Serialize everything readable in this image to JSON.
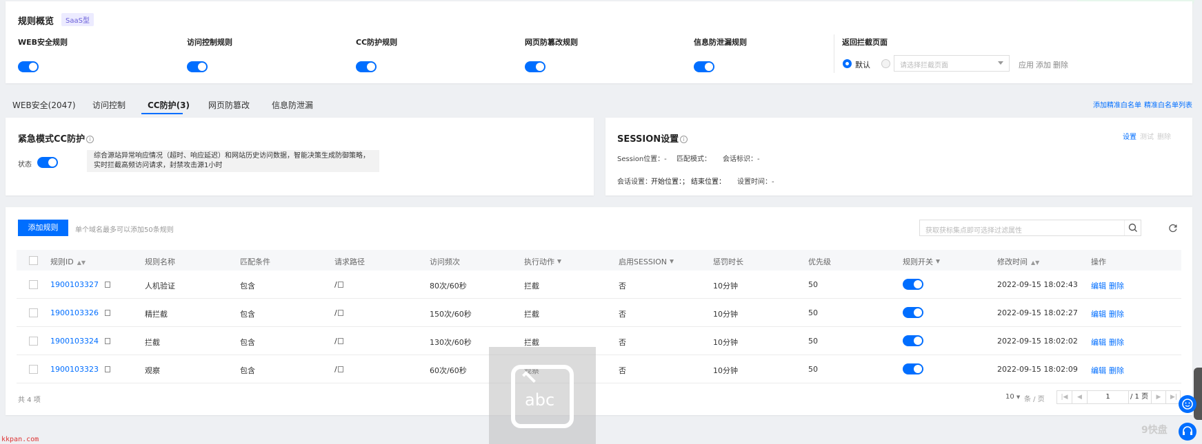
{
  "overview": {
    "title": "规则概览",
    "badge": "SaaS型",
    "rules": [
      {
        "label": "WEB安全规则"
      },
      {
        "label": "访问控制规则"
      },
      {
        "label": "CC防护规则"
      },
      {
        "label": "网页防篡改规则"
      },
      {
        "label": "信息防泄漏规则"
      }
    ],
    "return_page": {
      "label": "返回拦截页面",
      "default_option": "默认",
      "select_placeholder": "请选择拦截页面",
      "apply": "应用",
      "add": "添加",
      "delete": "删除"
    }
  },
  "tabs": [
    {
      "label": "WEB安全(2047)"
    },
    {
      "label": "访问控制"
    },
    {
      "label": "CC防护(3)"
    },
    {
      "label": "网页防篡改"
    },
    {
      "label": "信息防泄漏"
    }
  ],
  "top_links": {
    "add_whitelist": "添加精准白名单",
    "whitelist_list": "精准白名单列表"
  },
  "emergency": {
    "title": "紧急模式CC防护",
    "status_label": "状态",
    "description_line1": "综合源站异常响应情况（超时、响应延迟）和网站历史访问数据，智能决策生成防御策略，",
    "description_line2": "实时拦截高频访问请求，封禁攻击源1小时"
  },
  "session": {
    "title": "SESSION设置",
    "actions": {
      "set": "设置",
      "test": "测试",
      "delete": "删除"
    },
    "fields": {
      "position": "Session位置：-",
      "match_mode": "匹配模式：",
      "session_id": "会话标识：-",
      "session_setting": "会话设置：",
      "start_pos": "开始位置：；",
      "end_pos": "结束位置：",
      "set_time": "设置时间：-"
    }
  },
  "rules_table": {
    "add_button": "添加规则",
    "hint": "单个域名最多可以添加50条规则",
    "search_placeholder": "获取获标集点即可选择过滤属性",
    "columns": [
      {
        "label": "规则ID",
        "sort": true
      },
      {
        "label": "规则名称"
      },
      {
        "label": "匹配条件"
      },
      {
        "label": "请求路径"
      },
      {
        "label": "访问频次"
      },
      {
        "label": "执行动作",
        "filter": true
      },
      {
        "label": "启用SESSION",
        "filter": true
      },
      {
        "label": "惩罚时长"
      },
      {
        "label": "优先级"
      },
      {
        "label": "规则开关",
        "filter": true
      },
      {
        "label": "修改时间",
        "sort": true
      },
      {
        "label": "操作"
      }
    ],
    "rows": [
      {
        "id": "1900103327",
        "name": "人机验证",
        "match": "包含",
        "path": "/",
        "freq": "80次/60秒",
        "action": "拦截",
        "session": "否",
        "penalty": "10分钟",
        "priority": "50",
        "switch": true,
        "mtime": "2022-09-15 18:02:43",
        "edit": "编辑",
        "delete": "删除"
      },
      {
        "id": "1900103326",
        "name": "精拦截",
        "match": "包含",
        "path": "/",
        "freq": "150次/60秒",
        "action": "拦截",
        "session": "否",
        "penalty": "10分钟",
        "priority": "50",
        "switch": true,
        "mtime": "2022-09-15 18:02:27",
        "edit": "编辑",
        "delete": "删除"
      },
      {
        "id": "1900103324",
        "name": "拦截",
        "match": "包含",
        "path": "/",
        "freq": "130次/60秒",
        "action": "拦截",
        "session": "否",
        "penalty": "10分钟",
        "priority": "50",
        "switch": true,
        "mtime": "2022-09-15 18:02:02",
        "edit": "编辑",
        "delete": "删除"
      },
      {
        "id": "1900103323",
        "name": "观察",
        "match": "包含",
        "path": "/",
        "freq": "60次/60秒",
        "action": "观察",
        "session": "否",
        "penalty": "10分钟",
        "priority": "50",
        "switch": true,
        "mtime": "2022-09-15 18:02:09",
        "edit": "编辑",
        "delete": "删除"
      }
    ],
    "footer": {
      "total": "共 4 项",
      "page_size": "10",
      "page_size_unit": "条 / 页",
      "current_page": "1",
      "total_pages": "/ 1 页"
    }
  },
  "watermark": {
    "abc": "abc",
    "site": "kkpan.com",
    "corner": "9快盘"
  }
}
